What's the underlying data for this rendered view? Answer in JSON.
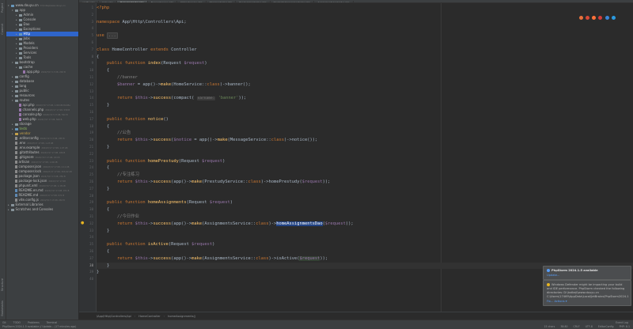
{
  "tabs": [
    {
      "label": "config.php",
      "active": false
    },
    {
      "label": "login.php",
      "active": false
    },
    {
      "label": "HomeController.php",
      "active": true
    },
    {
      "label": "BannerService.php",
      "active": false
    },
    {
      "label": "NoticeService.php",
      "active": false
    },
    {
      "label": "ShopController.php",
      "active": false
    },
    {
      "label": "PrestudyController.php",
      "active": false
    },
    {
      "label": "StudentCategoryController.php",
      "active": false
    },
    {
      "label": "AssignmentsController.php",
      "active": false
    }
  ],
  "tool_windows": {
    "left": [
      "Project",
      "Commit",
      "Structure",
      "Bookmarks"
    ],
    "bottom": [
      "Git",
      "TODO",
      "Problems",
      "Terminal"
    ],
    "bottom_right": "Event Log"
  },
  "project_tree": [
    {
      "label": "www.douyu.cn",
      "meta": "D:\\txdkeji\\www.douyu.cn",
      "indent": 0,
      "kind": "folder-blue",
      "expanded": true
    },
    {
      "label": "app",
      "indent": 1,
      "kind": "folder",
      "expanded": true
    },
    {
      "label": "Admin",
      "indent": 2,
      "kind": "folder",
      "expanded": false
    },
    {
      "label": "Console",
      "indent": 2,
      "kind": "folder",
      "expanded": false
    },
    {
      "label": "Dao",
      "indent": 2,
      "kind": "folder",
      "expanded": false
    },
    {
      "label": "Exceptions",
      "indent": 2,
      "kind": "folder",
      "expanded": false
    },
    {
      "label": "Http",
      "indent": 2,
      "kind": "folder-blue",
      "expanded": false,
      "state": "selected-main"
    },
    {
      "label": "Jobs",
      "indent": 2,
      "kind": "folder",
      "expanded": false
    },
    {
      "label": "Models",
      "indent": 2,
      "kind": "folder",
      "expanded": false
    },
    {
      "label": "Providers",
      "indent": 2,
      "kind": "folder",
      "expanded": false
    },
    {
      "label": "Services",
      "indent": 2,
      "kind": "folder",
      "expanded": false
    },
    {
      "label": "Tools",
      "indent": 2,
      "kind": "folder",
      "expanded": false
    },
    {
      "label": "bootstrap",
      "indent": 1,
      "kind": "folder",
      "expanded": true
    },
    {
      "label": "cache",
      "indent": 2,
      "kind": "folder",
      "expanded": false
    },
    {
      "label": "app.php",
      "meta": "2024/7/17 17:08, 263 B",
      "indent": 3,
      "kind": "file-php"
    },
    {
      "label": "config",
      "indent": 1,
      "kind": "folder",
      "expanded": false
    },
    {
      "label": "database",
      "indent": 1,
      "kind": "folder",
      "expanded": false
    },
    {
      "label": "lang",
      "indent": 1,
      "kind": "folder",
      "expanded": false
    },
    {
      "label": "public",
      "indent": 1,
      "kind": "folder",
      "expanded": false
    },
    {
      "label": "resources",
      "indent": 1,
      "kind": "folder",
      "expanded": false
    },
    {
      "label": "routes",
      "indent": 1,
      "kind": "folder",
      "expanded": true
    },
    {
      "label": "api.php",
      "meta": "2024/7/17 17:08, 1.89 kB Modifie",
      "indent": 2,
      "kind": "file-php"
    },
    {
      "label": "channels.php",
      "meta": "2024/7/17 17:08, 558 B",
      "indent": 2,
      "kind": "file-php"
    },
    {
      "label": "console.php",
      "meta": "2024/7/17 17:08, 592 B",
      "indent": 2,
      "kind": "file-php"
    },
    {
      "label": "web.php",
      "meta": "2024/7/17 17:08, 566 B",
      "indent": 2,
      "kind": "file-php"
    },
    {
      "label": "storage",
      "indent": 1,
      "kind": "folder",
      "expanded": false
    },
    {
      "label": "tests",
      "indent": 1,
      "kind": "folder-blue",
      "expanded": false,
      "state": "green"
    },
    {
      "label": "vendor",
      "indent": 1,
      "kind": "folder-yellow",
      "expanded": false,
      "state": "yellowtext"
    },
    {
      "label": ".editorconfig",
      "meta": "2024/7/17 17:08, 258 B",
      "indent": 1,
      "kind": "file-other"
    },
    {
      "label": ".env",
      "meta": "2024/7/17 17:08, 1.23 kB",
      "indent": 1,
      "kind": "file-other"
    },
    {
      "label": ".env.example",
      "meta": "2024/7/17 17:08, 1.07 kB",
      "indent": 1,
      "kind": "file-other"
    },
    {
      "label": ".gitattributes",
      "meta": "2024/7/17 17:08, 186 B",
      "indent": 1,
      "kind": "file-other"
    },
    {
      "label": ".gitignore",
      "meta": "2024/7/17 17:08, 243 B",
      "indent": 1,
      "kind": "file-other"
    },
    {
      "label": "artisan",
      "meta": "2024/7/17 17:08, 1.69 kB",
      "indent": 1,
      "kind": "file-other"
    },
    {
      "label": "composer.json",
      "meta": "2024/7/17 17:08, 2.11 kB",
      "indent": 1,
      "kind": "file-other"
    },
    {
      "label": "composer.lock",
      "meta": "2024/7/17 17:08, 303.62 kB",
      "indent": 1,
      "kind": "file-other"
    },
    {
      "label": "package.json",
      "meta": "2024/7/17 17:08, 259 B",
      "indent": 1,
      "kind": "file-other"
    },
    {
      "label": "package-lock.json",
      "meta": "2024/7/17 17:08",
      "indent": 1,
      "kind": "file-other"
    },
    {
      "label": "phpunit.xml",
      "meta": "2024/7/17 17:08, 1.18 kB",
      "indent": 1,
      "kind": "file-other"
    },
    {
      "label": "README.en.md",
      "meta": "2024/7/17 17:08, 971 B",
      "indent": 1,
      "kind": "file-md"
    },
    {
      "label": "README.md",
      "meta": "2024/7/17 17:08, 971 B",
      "indent": 1,
      "kind": "file-md"
    },
    {
      "label": "vite.config.js",
      "meta": "2024/7/17 17:08, 263 B",
      "indent": 1,
      "kind": "file-other"
    },
    {
      "label": "External Libraries",
      "indent": 0,
      "kind": "folder",
      "expanded": false
    },
    {
      "label": "Scratches and Consoles",
      "indent": 0,
      "kind": "folder",
      "expanded": false
    }
  ],
  "editor": {
    "current_line": 38,
    "lines": [
      {
        "n": 1,
        "html": "<span class=\"php\">&lt;?php</span>"
      },
      {
        "n": 2,
        "html": ""
      },
      {
        "n": 3,
        "html": "<span class=\"kw\">namespace</span> App\\Http\\Controllers\\Api;"
      },
      {
        "n": 4,
        "html": ""
      },
      {
        "n": 5,
        "html": "<span class=\"kw\">use</span> <span class=\"fold\">...</span>"
      },
      {
        "n": 6,
        "html": ""
      },
      {
        "n": 7,
        "html": "<span class=\"kw\">class</span> HomeController <span class=\"kw\">extends</span> Controller"
      },
      {
        "n": 8,
        "html": "{"
      },
      {
        "n": 9,
        "html": "    <span class=\"kw\">public function</span> <span class=\"fn\">index</span>(Request <span class=\"var\">$request</span>)"
      },
      {
        "n": 10,
        "html": "    {"
      },
      {
        "n": 11,
        "html": "        <span class=\"cm\">//banner</span>"
      },
      {
        "n": 12,
        "html": "        <span class=\"var\">$banner</span> = app()-><span class=\"fn\">make</span>(HomeService::<span class=\"kw\">class</span>)->banner();"
      },
      {
        "n": 13,
        "html": ""
      },
      {
        "n": 14,
        "html": "        <span class=\"kw\">return</span> <span class=\"var\">$this</span>-><span class=\"fn\">success</span>(compact( <span class=\"hint\">varname:</span> <span class=\"str\">'banner'</span>));"
      },
      {
        "n": 15,
        "html": "    }"
      },
      {
        "n": 16,
        "html": ""
      },
      {
        "n": 17,
        "html": "    <span class=\"kw\">public function</span> <span class=\"fn\">notice</span>()"
      },
      {
        "n": 18,
        "html": "    {"
      },
      {
        "n": 19,
        "html": "        <span class=\"cm\">//公告</span>"
      },
      {
        "n": 20,
        "html": "        <span class=\"kw\">return</span> <span class=\"var\">$this</span>-><span class=\"fn\">success</span>(<span class=\"var\">$notice</span> = app()-><span class=\"fn\">make</span>(MessageService::<span class=\"kw\">class</span>)->notice());"
      },
      {
        "n": 21,
        "html": "    }"
      },
      {
        "n": 22,
        "html": ""
      },
      {
        "n": 23,
        "html": "    <span class=\"kw\">public function</span> <span class=\"fn\">homePrestudy</span>(Request <span class=\"var\">$request</span>)"
      },
      {
        "n": 24,
        "html": "    {"
      },
      {
        "n": 25,
        "html": "        <span class=\"cm\">//专注练习</span>"
      },
      {
        "n": 26,
        "html": "        <span class=\"kw\">return</span> <span class=\"var\">$this</span>-><span class=\"fn\">success</span>(app()-><span class=\"fn\">make</span>(PrestudyService::<span class=\"kw\">class</span>)->homePrestudy(<span class=\"var\">$request</span>));"
      },
      {
        "n": 27,
        "html": "    }"
      },
      {
        "n": 28,
        "html": ""
      },
      {
        "n": 29,
        "html": "    <span class=\"kw\">public function</span> <span class=\"fn\">homeAssignments</span>(Request <span class=\"var\">$request</span>)"
      },
      {
        "n": 30,
        "html": "    {"
      },
      {
        "n": 31,
        "html": "        <span class=\"cm\">//今日作业</span>"
      },
      {
        "n": 32,
        "html": "        <span class=\"kw\">return</span> <span class=\"var\">$this</span>-><span class=\"fn\">success</span>(app()-><span class=\"fn\">make</span>(AssignmentsService::<span class=\"kw\">class</span>)-><span class=\"match\">homeAssignmentsDao</span>(<span class=\"var\">$request</span>));"
      },
      {
        "n": 33,
        "html": "    }"
      },
      {
        "n": 34,
        "html": ""
      },
      {
        "n": 35,
        "html": "    <span class=\"kw\">public function</span> <span class=\"fn\">isActive</span>(Request <span class=\"var\">$request</span>)"
      },
      {
        "n": 36,
        "html": "    {"
      },
      {
        "n": 37,
        "html": "        <span class=\"kw\">return</span> <span class=\"var\">$this</span>-><span class=\"fn\">success</span>(app()-><span class=\"fn\">make</span>(AssignmentsService::<span class=\"kw\">class</span>)->isActive(<span class=\"usage var\">$request</span>));"
      },
      {
        "n": 38,
        "html": "    }"
      },
      {
        "n": 39,
        "html": "}"
      },
      {
        "n": 40,
        "html": ""
      }
    ]
  },
  "breadcrumb": [
    "\\App\\Http\\Controllers\\Api",
    "HomeController",
    "homeAssignments()"
  ],
  "notifications": [
    {
      "title": "PhpStorm 2024.1.5 available",
      "body": "",
      "link": "Update...",
      "color": "#589df6"
    },
    {
      "title": "",
      "body": "Windows Defender might be impacting your build and IDE performance. PhpStorm checked the following directories: D:\\txdkeji\\www.douyu.cn C:\\Users\\17469\\AppData\\Local\\JetBrains\\PhpStorm2024.1",
      "link": "Fix...   Actions ▾",
      "color": "#e6b422"
    }
  ],
  "status": {
    "left": "PhpStorm 2024.1.5 available // Update... (17 minutes ago)",
    "position": "38:80",
    "line_sep": "CRLF",
    "encoding": "UTF-8",
    "settings": "EditorConfig",
    "lang": "PHP: 8.1",
    "chars": "15 chars"
  },
  "colors": {
    "background": "#2b2b2b",
    "panel": "#3c3f41",
    "selection": "#2f65ca",
    "keyword": "#cc7832",
    "function": "#ffc66d",
    "variable": "#9876aa",
    "string": "#6a8759",
    "comment": "#808080"
  }
}
